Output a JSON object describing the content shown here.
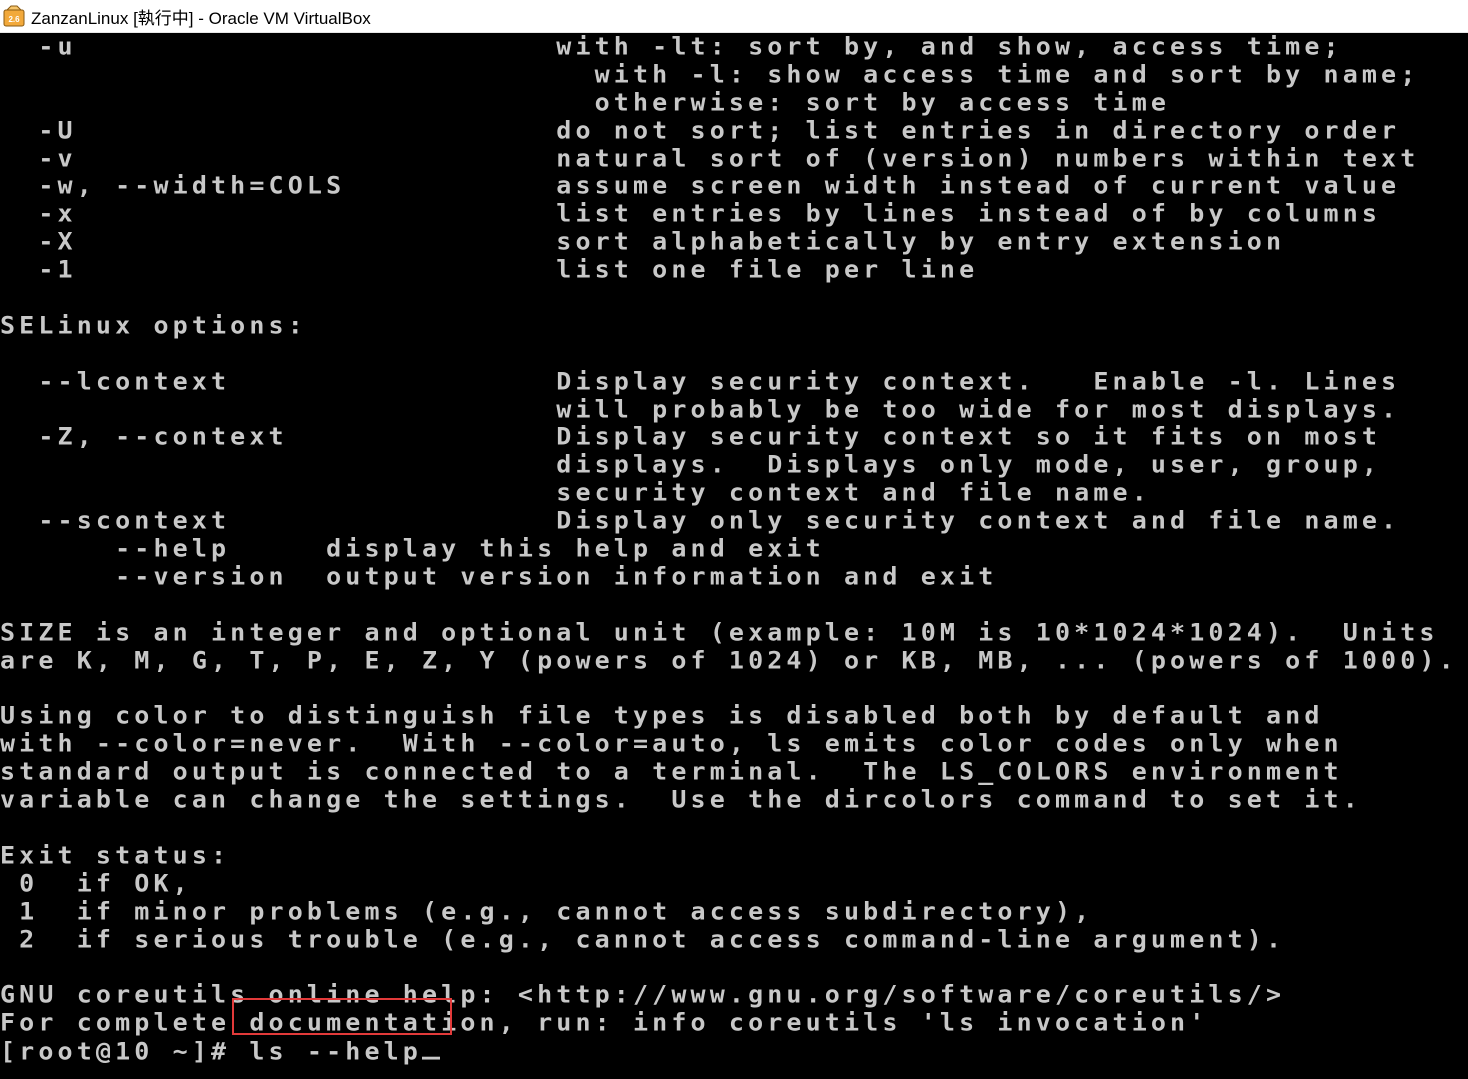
{
  "window": {
    "title": "ZanzanLinux [執行中] - Oracle VM VirtualBox",
    "icon": "virtualbox-icon",
    "icon_badge": "2.6"
  },
  "terminal": {
    "lines": [
      "  -u                         with -lt: sort by, and show, access time;",
      "                               with -l: show access time and sort by name;",
      "                               otherwise: sort by access time",
      "  -U                         do not sort; list entries in directory order",
      "  -v                         natural sort of (version) numbers within text",
      "  -w, --width=COLS           assume screen width instead of current value",
      "  -x                         list entries by lines instead of by columns",
      "  -X                         sort alphabetically by entry extension",
      "  -1                         list one file per line",
      "",
      "SELinux options:",
      "",
      "  --lcontext                 Display security context.   Enable -l. Lines",
      "                             will probably be too wide for most displays.",
      "  -Z, --context              Display security context so it fits on most",
      "                             displays.  Displays only mode, user, group,",
      "                             security context and file name.",
      "  --scontext                 Display only security context and file name.",
      "      --help     display this help and exit",
      "      --version  output version information and exit",
      "",
      "SIZE is an integer and optional unit (example: 10M is 10*1024*1024).  Units",
      "are K, M, G, T, P, E, Z, Y (powers of 1024) or KB, MB, ... (powers of 1000).",
      "",
      "Using color to distinguish file types is disabled both by default and",
      "with --color=never.  With --color=auto, ls emits color codes only when",
      "standard output is connected to a terminal.  The LS_COLORS environment",
      "variable can change the settings.  Use the dircolors command to set it.",
      "",
      "Exit status:",
      " 0  if OK,",
      " 1  if minor problems (e.g., cannot access subdirectory),",
      " 2  if serious trouble (e.g., cannot access command-line argument).",
      "",
      "GNU coreutils online help: <http://www.gnu.org/software/coreutils/>",
      "For complete documentation, run: info coreutils 'ls invocation'"
    ],
    "prompt": "[root@10 ~]# ",
    "command": "ls --help"
  },
  "colors": {
    "terminal_bg": "#000000",
    "terminal_fg": "#c8c8c8",
    "highlight_border": "#e23a3a"
  }
}
